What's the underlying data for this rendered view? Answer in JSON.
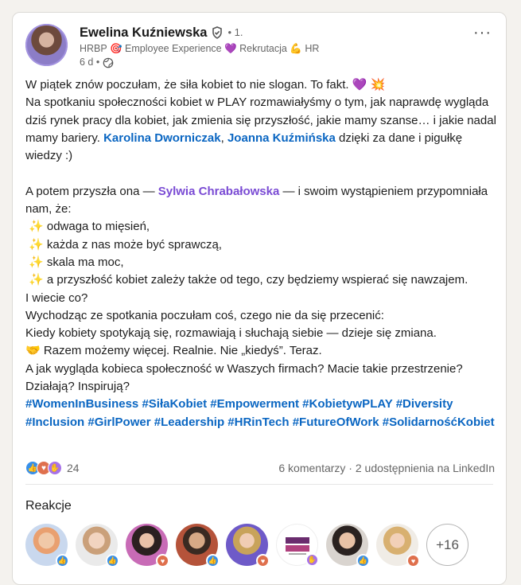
{
  "author": {
    "name": "Ewelina Kuźniewska",
    "degree": "• 1.",
    "headline": "HRBP 🎯 Employee Experience 💜 Rekrutacja 💪 HR",
    "time": "6 d •"
  },
  "post": {
    "line1": "W piątek znów poczułam, że siła kobiet to nie slogan. To fakt. 💜 💥",
    "para1_a": "Na spotkaniu społeczności kobiet w PLAY rozmawiałyśmy o tym, jak naprawdę wygląda dziś rynek pracy dla kobiet, jak zmienia się przyszłość, jakie mamy szanse… i jakie nadal mamy bariery. ",
    "mention1": "Karolina Dworniczak",
    "sep1": ", ",
    "mention2": "Joanna Kuźmińska",
    "para1_b": " dzięki za dane i pigułkę wiedzy :)",
    "para2_a": "A potem przyszła ona — ",
    "mention3": "Sylwia Chrabałowska",
    "para2_b": " — i swoim wystąpieniem przypomniała nam, że:",
    "bullets": [
      "odwaga to mięsień,",
      "każda z nas może być sprawczą,",
      "skala ma moc,",
      "a przyszłość kobiet zależy także od tego, czy będziemy wspierać się nawzajem."
    ],
    "line_wiecie": "I wiecie co?",
    "line_wychodzac": " Wychodząc ze spotkania poczułam coś, czego nie da się przecenić:",
    "line_kiedy": " Kiedy kobiety spotykają się, rozmawiają i słuchają siebie — dzieje się zmiana.",
    "line_razem": "🤝 Razem możemy więcej. Realnie. Nie „kiedyś”. Teraz.",
    "line_question": "A jak wygląda kobieca społeczność w Waszych firmach? Macie takie przestrzenie? Działają? Inspirują?",
    "hashtags": [
      "#WomenInBusiness",
      "#SiłaKobiet",
      "#Empowerment",
      "#KobietywPLAY",
      "#Diversity",
      "#Inclusion",
      "#GirlPower",
      "#Leadership",
      "#HRinTech",
      "#FutureOfWork",
      "#SolidarnośćKobiet"
    ]
  },
  "social": {
    "reaction_count": "24",
    "comments_shares": "6 komentarzy · 2 udostępnienia na LinkedIn"
  },
  "reactions": {
    "title": "Reakcje",
    "more": "+16"
  },
  "colors": {
    "link": "#0a66c2",
    "mention_purple": "#7a4bd4"
  }
}
